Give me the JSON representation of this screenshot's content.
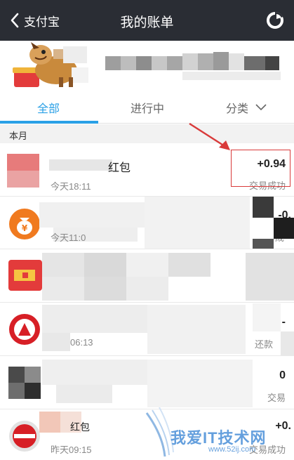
{
  "header": {
    "back_label": "支付宝",
    "title": "我的账单"
  },
  "tabs": [
    {
      "label": "全部"
    },
    {
      "label": "进行中"
    },
    {
      "label": "分类"
    }
  ],
  "month_label": "本月",
  "transactions": [
    {
      "title": "红包",
      "date": "今天18:11",
      "amount": "+0.94",
      "status": "交易成功"
    },
    {
      "title": "",
      "date": "今天11:0",
      "amount": "-0.",
      "status": "成"
    },
    {
      "title": "",
      "date": "",
      "amount": "",
      "status": ""
    },
    {
      "title": "",
      "date": "06:13",
      "amount": "-",
      "status": "还款"
    },
    {
      "title": "",
      "date": "",
      "amount": "0",
      "status": "交易"
    },
    {
      "title": "红包",
      "date": "昨天09:15",
      "amount": "+0.",
      "status": "交易成功"
    }
  ],
  "watermark": {
    "text": "我爱IT技术网",
    "url": "www.52ij.com"
  },
  "colors": {
    "header_bg": "#2a2d34",
    "accent": "#2aa0e6",
    "highlight": "#d93a3a"
  },
  "icons": {
    "back": "chevron-left-icon",
    "stats": "pie-chart-icon",
    "category": "chevron-down-icon"
  }
}
